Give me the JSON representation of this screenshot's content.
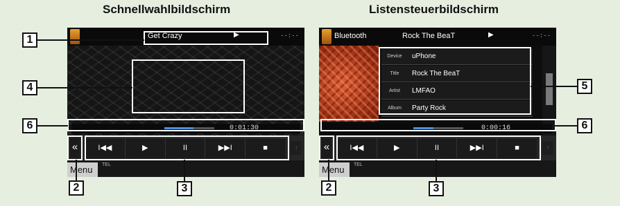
{
  "left_panel": {
    "title": "Schnellwahlbildschirm",
    "source_name": "",
    "track_title": "Get Crazy",
    "play_icon": "▶",
    "clock": "--:--",
    "elapsed": "0:01:30",
    "progress_fraction": 0.58,
    "controls": {
      "collapse": "«",
      "prev": "I◀◀",
      "play": "▶",
      "pause": "II",
      "next": "▶▶I",
      "stop": "■"
    },
    "side_button": "↑",
    "menu_label": "Menu",
    "mini_label": "TEL"
  },
  "right_panel": {
    "title": "Listensteuerbildschirm",
    "source_name": "Bluetooth",
    "track_title": "Rock The BeaT",
    "play_icon": "▶",
    "clock": "--:--",
    "elapsed": "0:00:16",
    "progress_fraction": 0.4,
    "list": [
      {
        "label": "Device",
        "value": "uPhone"
      },
      {
        "label": "Title",
        "value": "Rock The BeaT"
      },
      {
        "label": "Artist",
        "value": "LMFAO"
      },
      {
        "label": "Album",
        "value": "Party Rock"
      }
    ],
    "controls": {
      "collapse": "«",
      "prev": "I◀◀",
      "play": "▶",
      "pause": "II",
      "next": "▶▶I",
      "stop": "■"
    },
    "side_button": "↑",
    "menu_label": "Menu",
    "mini_label": "TEL"
  },
  "callouts": {
    "c1": "1",
    "c2_left": "2",
    "c3_left": "3",
    "c4": "4",
    "c5": "5",
    "c6_left": "6",
    "c6_right": "6",
    "c2_right": "2",
    "c3_right": "3"
  },
  "colors": {
    "background": "#e6eee0",
    "progress_fill": "#4f8ee0",
    "screen": "#0d0d0d"
  }
}
